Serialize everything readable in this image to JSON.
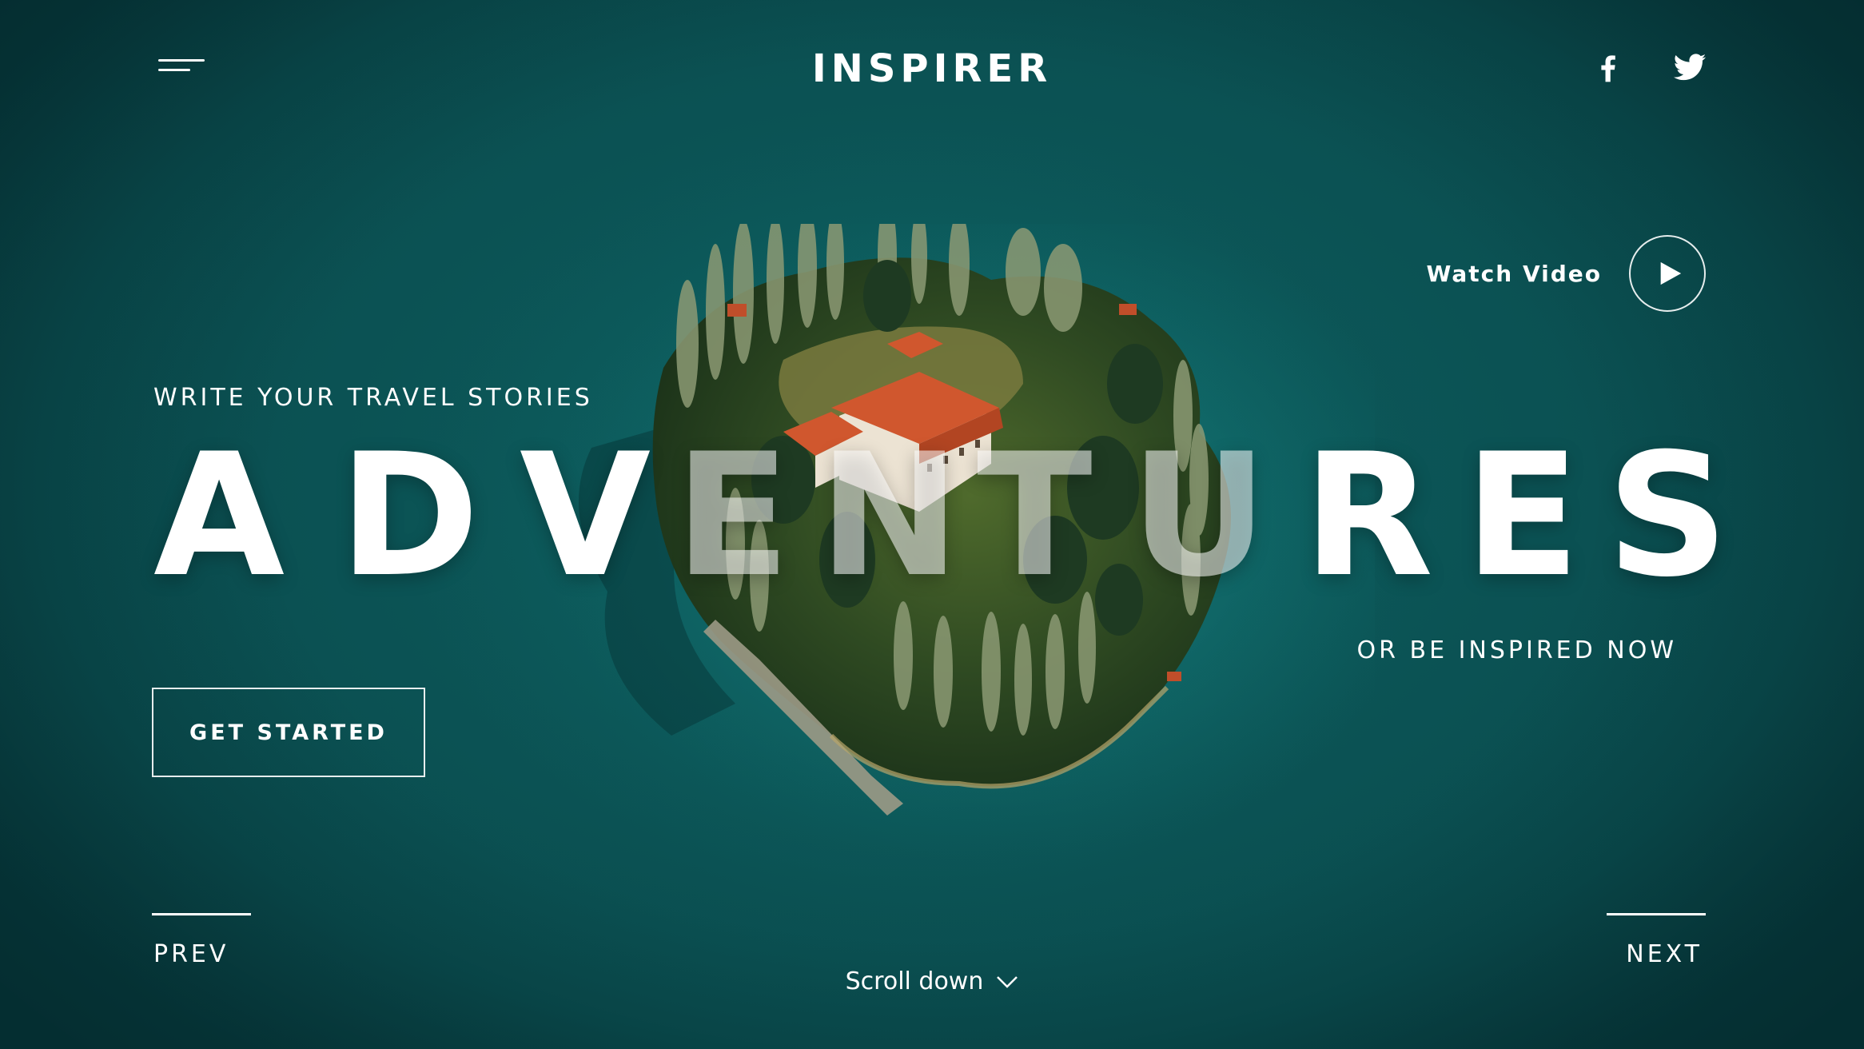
{
  "header": {
    "brand": "INSPIRER",
    "menu_icon": "hamburger-icon",
    "social": [
      {
        "icon": "facebook-icon"
      },
      {
        "icon": "twitter-icon"
      }
    ]
  },
  "video": {
    "label": "Watch Video",
    "icon": "play-icon"
  },
  "hero": {
    "kicker": "WRITE YOUR TRAVEL STORIES",
    "headline_letters": [
      "A",
      "D",
      "V",
      "E",
      "N",
      "T",
      "U",
      "R",
      "E",
      "S"
    ],
    "subtitle": "OR BE INSPIRED NOW",
    "cta_label": "GET STARTED"
  },
  "nav": {
    "prev_label": "PREV",
    "next_label": "NEXT",
    "scroll_label": "Scroll down",
    "scroll_icon": "chevron-down-icon"
  },
  "colors": {
    "background": "#0c5556",
    "text": "#ffffff",
    "roof_accent": "#d0572e"
  }
}
